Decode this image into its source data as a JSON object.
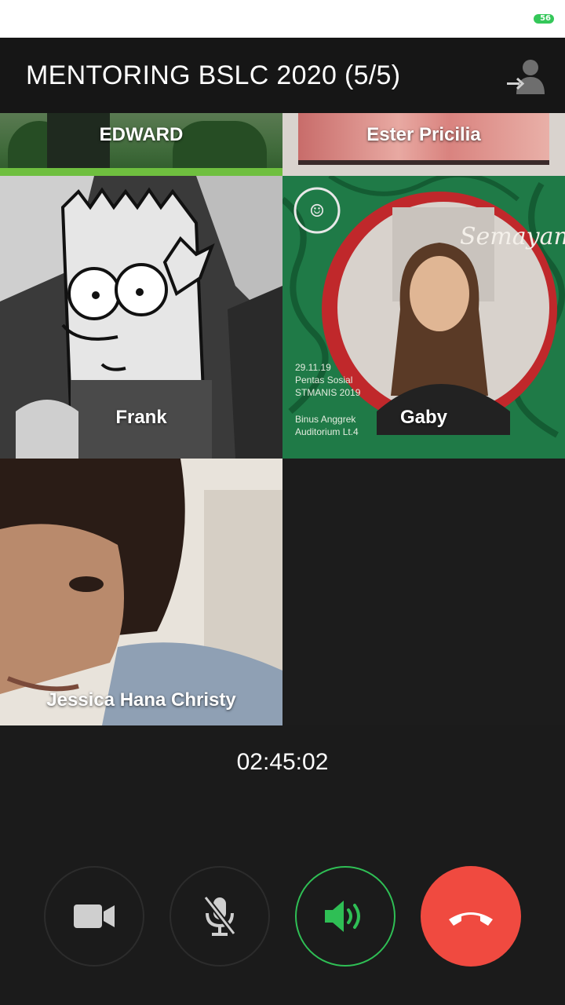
{
  "status_bar": {
    "battery_level": "56"
  },
  "header": {
    "title": "MENTORING BSLC 2020 (5/5)",
    "icon": "add-member-icon"
  },
  "participants": [
    {
      "name": "EDWARD"
    },
    {
      "name": "Ester Pricilia"
    },
    {
      "name": "Frank"
    },
    {
      "name": "Gaby"
    },
    {
      "name": "Jessica Hana Christy"
    }
  ],
  "gaby_poster": {
    "script_title": "Semayam",
    "line1": "29.11.19",
    "line2": "Pentas Sosial",
    "line3": "STMANIS 2019",
    "line4": "Binus Anggrek",
    "line5": "Auditorium Lt.4"
  },
  "call": {
    "duration": "02:45:02"
  },
  "controls": [
    {
      "icon": "video-camera-icon",
      "state": "off"
    },
    {
      "icon": "mic-muted-icon",
      "state": "muted"
    },
    {
      "icon": "speaker-icon",
      "state": "on",
      "color": "#2fbf55"
    },
    {
      "icon": "hang-up-icon",
      "state": "end",
      "color": "#f04a40"
    }
  ]
}
